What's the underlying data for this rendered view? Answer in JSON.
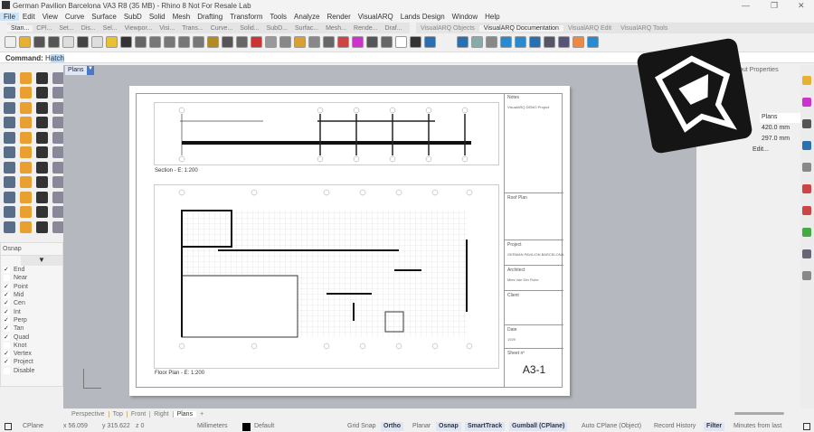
{
  "window": {
    "title": "German Pavilion Barcelona VA3 R8 (35 MB) - Rhino 8 Not For Resale Lab",
    "minimize": "—",
    "restore": "❐",
    "close": "✕"
  },
  "menu": [
    "File",
    "Edit",
    "View",
    "Curve",
    "Surface",
    "SubD",
    "Solid",
    "Mesh",
    "Drafting",
    "Transform",
    "Tools",
    "Analyze",
    "Render",
    "VisualARQ",
    "Lands Design",
    "Window",
    "Help"
  ],
  "toolbar_tabs": [
    "Stan...",
    "CPl...",
    "Set...",
    "Dis...",
    "Sel...",
    "Viewpor...",
    "Visi...",
    "Trans...",
    "Curve...",
    "Solid...",
    "SubD...",
    "Surfac...",
    "Mesh...",
    "Rende...",
    "Draf..."
  ],
  "va_tabs": [
    "VisualARQ Objects",
    "VisualARQ Documentation",
    "VisualARQ Edit",
    "VisualARQ Tools"
  ],
  "command": {
    "label": "Command:",
    "value_pre": "H",
    "value_sel": "atch"
  },
  "viewport": {
    "active_tab": "Plans"
  },
  "osnap": {
    "title": "Osnap",
    "items": [
      {
        "label": "End",
        "checked": true
      },
      {
        "label": "Near",
        "checked": false
      },
      {
        "label": "Point",
        "checked": true
      },
      {
        "label": "Mid",
        "checked": true
      },
      {
        "label": "Cen",
        "checked": true
      },
      {
        "label": "Int",
        "checked": true
      },
      {
        "label": "Perp",
        "checked": true
      },
      {
        "label": "Tan",
        "checked": true
      },
      {
        "label": "Quad",
        "checked": true
      },
      {
        "label": "Knot",
        "checked": false
      },
      {
        "label": "Vertex",
        "checked": true
      },
      {
        "label": "Project",
        "checked": true
      },
      {
        "label": "Disable",
        "checked": false
      }
    ]
  },
  "layout": {
    "section_label": "Section - E: 1:200",
    "plan_label": "Floor Plan - E: 1:200",
    "grid_top": [
      "A",
      "B",
      "C",
      "D",
      "E",
      "F"
    ],
    "titleblock": {
      "notes": "Notes",
      "notes_text": "VisualARQ DEMO Project",
      "roof": "Roof Plan",
      "project": "Project",
      "project_val": "GERMAN PAVILION BARCELONA",
      "architect": "Architect",
      "architect_val": "Mies Van Der Rohe",
      "client": "Client",
      "date": "Date",
      "date_val": "1929",
      "sheet": "Sheet nº",
      "sheet_val": "A3-1"
    }
  },
  "properties": {
    "title": "out Properties",
    "name": "Plans",
    "width": "420.0 mm",
    "height": "297.0 mm",
    "edit": "Edit..."
  },
  "viewport_tabs": [
    "Perspective",
    "Top",
    "Front",
    "Right",
    "Plans"
  ],
  "status": {
    "cplane": "CPlane",
    "x": "x 56.059",
    "y": "y 315.622",
    "z": "z 0",
    "units": "Millimeters",
    "layer": "Default",
    "grid_snap": "Grid Snap",
    "ortho": "Ortho",
    "planar": "Planar",
    "osnap": "Osnap",
    "smarttrack": "SmartTrack",
    "gumball": "Gumball (CPlane)",
    "autocplane": "Auto CPlane (Object)",
    "history": "Record History",
    "filter": "Filter",
    "minutes": "Minutes from last"
  }
}
